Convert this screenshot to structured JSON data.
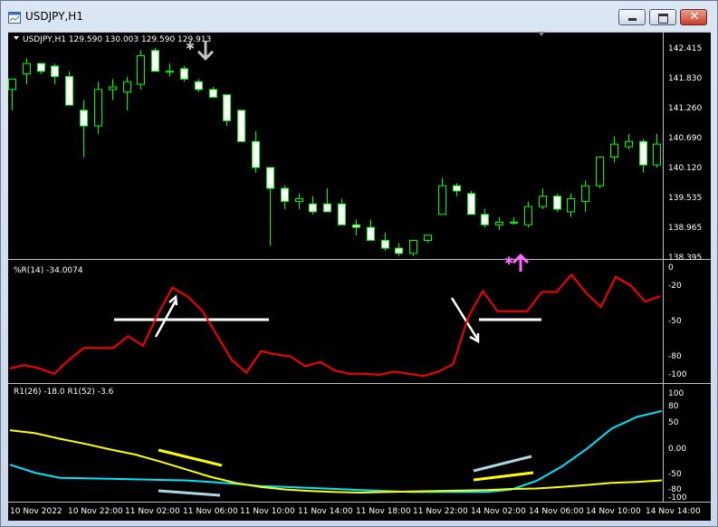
{
  "window": {
    "title": "USDJPY,H1",
    "icon": "chart-window-icon",
    "controls": [
      "minimize-icon",
      "maximize-icon",
      "close-icon"
    ]
  },
  "chart": {
    "header": "USDJPY,H1  129.590 130.003 129.590 129.913",
    "price_axis": [
      "142.415",
      "141.830",
      "141.260",
      "140.690",
      "140.120",
      "139.535",
      "138.965",
      "138.395"
    ],
    "wr_label": "%R(14) -34.0074",
    "wr_axis": [
      "0",
      "-20",
      "-50",
      "-80",
      "-100"
    ],
    "r1_label": "R1(26) -18.0  R1(52) -3.6",
    "r1_axis": [
      "100",
      "80",
      "50",
      "0.00",
      "-50",
      "-80",
      "-100"
    ],
    "time_axis": [
      "10 Nov 2022",
      "10 Nov 22:00",
      "11 Nov 02:00",
      "11 Nov 06:00",
      "11 Nov 10:00",
      "11 Nov 14:00",
      "11 Nov 18:00",
      "11 Nov 22:00",
      "14 Nov 02:00",
      "14 Nov 06:00",
      "14 Nov 10:00",
      "14 Nov 14:00"
    ],
    "colors": {
      "bull": "#00ff00",
      "bear": "#ffffff",
      "wr_line": "#ff0000",
      "r1_slow": "#ffff00",
      "r1_fast": "#00e5ff",
      "sell_arrow": "#c0c0c0",
      "buy_arrow": "#ff66ff"
    }
  },
  "chart_data": [
    {
      "type": "candlestick",
      "axis_range": [
        138.395,
        142.415
      ],
      "x_labels": [
        "10 Nov 2022",
        "10 Nov 22:00",
        "11 Nov 02:00",
        "11 Nov 06:00",
        "11 Nov 10:00",
        "11 Nov 14:00",
        "11 Nov 18:00",
        "11 Nov 22:00",
        "14 Nov 02:00",
        "14 Nov 06:00",
        "14 Nov 10:00",
        "14 Nov 14:00"
      ],
      "ohlc": [
        [
          141.6,
          141.8,
          141.2,
          141.8
        ],
        [
          141.9,
          142.2,
          141.7,
          142.1
        ],
        [
          142.1,
          142.1,
          141.9,
          141.95
        ],
        [
          142.05,
          142.1,
          141.7,
          141.85
        ],
        [
          141.85,
          141.95,
          141.3,
          141.3
        ],
        [
          141.2,
          141.4,
          140.3,
          140.9
        ],
        [
          140.9,
          141.75,
          140.75,
          141.6
        ],
        [
          141.6,
          141.8,
          141.4,
          141.65
        ],
        [
          141.55,
          141.85,
          141.2,
          141.75
        ],
        [
          141.7,
          142.35,
          141.6,
          142.25
        ],
        [
          142.35,
          142.4,
          141.95,
          141.95
        ],
        [
          141.95,
          142.1,
          141.85,
          141.95
        ],
        [
          142.0,
          142.05,
          141.75,
          141.8
        ],
        [
          141.75,
          141.8,
          141.55,
          141.6
        ],
        [
          141.6,
          141.65,
          141.5,
          141.45
        ],
        [
          141.5,
          141.5,
          140.9,
          141.0
        ],
        [
          141.2,
          141.2,
          140.6,
          140.6
        ],
        [
          140.6,
          140.8,
          140.0,
          140.1
        ],
        [
          140.1,
          140.1,
          138.6,
          139.7
        ],
        [
          139.7,
          139.75,
          139.3,
          139.45
        ],
        [
          139.45,
          139.6,
          139.3,
          139.5
        ],
        [
          139.4,
          139.55,
          139.2,
          139.25
        ],
        [
          139.4,
          139.7,
          139.25,
          139.25
        ],
        [
          139.4,
          139.5,
          139.0,
          139.0
        ],
        [
          139.0,
          139.1,
          138.8,
          138.95
        ],
        [
          138.95,
          139.1,
          138.75,
          138.7
        ],
        [
          138.7,
          138.85,
          138.5,
          138.55
        ],
        [
          138.55,
          138.65,
          138.4,
          138.45
        ],
        [
          138.45,
          138.7,
          138.4,
          138.7
        ],
        [
          138.7,
          138.8,
          138.65,
          138.8
        ],
        [
          139.2,
          139.9,
          139.2,
          139.75
        ],
        [
          139.75,
          139.8,
          139.55,
          139.65
        ],
        [
          139.6,
          139.65,
          139.2,
          139.2
        ],
        [
          139.2,
          139.3,
          138.95,
          139.0
        ],
        [
          139.0,
          139.15,
          138.9,
          139.05
        ],
        [
          139.05,
          139.15,
          139.0,
          139.05
        ],
        [
          139.0,
          139.45,
          138.95,
          139.35
        ],
        [
          139.35,
          139.7,
          139.3,
          139.55
        ],
        [
          139.55,
          139.6,
          139.25,
          139.3
        ],
        [
          139.25,
          139.6,
          139.15,
          139.5
        ],
        [
          139.45,
          139.85,
          139.25,
          139.75
        ],
        [
          139.75,
          140.3,
          139.7,
          140.3
        ],
        [
          140.3,
          140.7,
          140.2,
          140.55
        ],
        [
          140.5,
          140.75,
          140.45,
          140.6
        ],
        [
          140.6,
          140.65,
          140.0,
          140.15
        ],
        [
          140.15,
          140.75,
          140.1,
          140.55
        ]
      ],
      "signals": [
        {
          "type": "sell",
          "bar": 13,
          "price": 142.4
        },
        {
          "type": "buy",
          "bar": 35,
          "price": 138.55
        }
      ]
    },
    {
      "type": "line",
      "series": [
        {
          "name": "%R(14)",
          "values": [
            -94,
            -91,
            -94,
            -99,
            -86,
            -75,
            -75,
            -75,
            -64,
            -73,
            -44,
            -19,
            -27,
            -40,
            -63,
            -86,
            -98,
            -78,
            -81,
            -83,
            -92,
            -88,
            -96,
            -99,
            -99,
            -100,
            -97,
            -99,
            -101,
            -97,
            -90,
            -47,
            -22,
            -41,
            -41,
            -41,
            -23,
            -23,
            -7,
            -24,
            -37,
            -9,
            -17,
            -32,
            -27
          ]
        }
      ],
      "ylim": [
        -100,
        0
      ]
    },
    {
      "type": "line",
      "series": [
        {
          "name": "R1(26)",
          "values": [
            -36,
            -52,
            -62,
            -63,
            -64,
            -65,
            -66,
            -67,
            -70,
            -74,
            -78,
            -80,
            -82,
            -84,
            -86,
            -88,
            -90,
            -90,
            -90,
            -90,
            -85,
            -68,
            -40,
            -5,
            35,
            58,
            70
          ]
        },
        {
          "name": "R1(52)",
          "values": [
            32,
            26,
            15,
            5,
            -6,
            -16,
            -30,
            -45,
            -60,
            -72,
            -80,
            -85,
            -88,
            -90,
            -91,
            -90,
            -89,
            -88,
            -87,
            -86,
            -84,
            -83,
            -80,
            -76,
            -72,
            -70,
            -67
          ]
        }
      ],
      "ylim": [
        -100,
        100
      ]
    }
  ]
}
